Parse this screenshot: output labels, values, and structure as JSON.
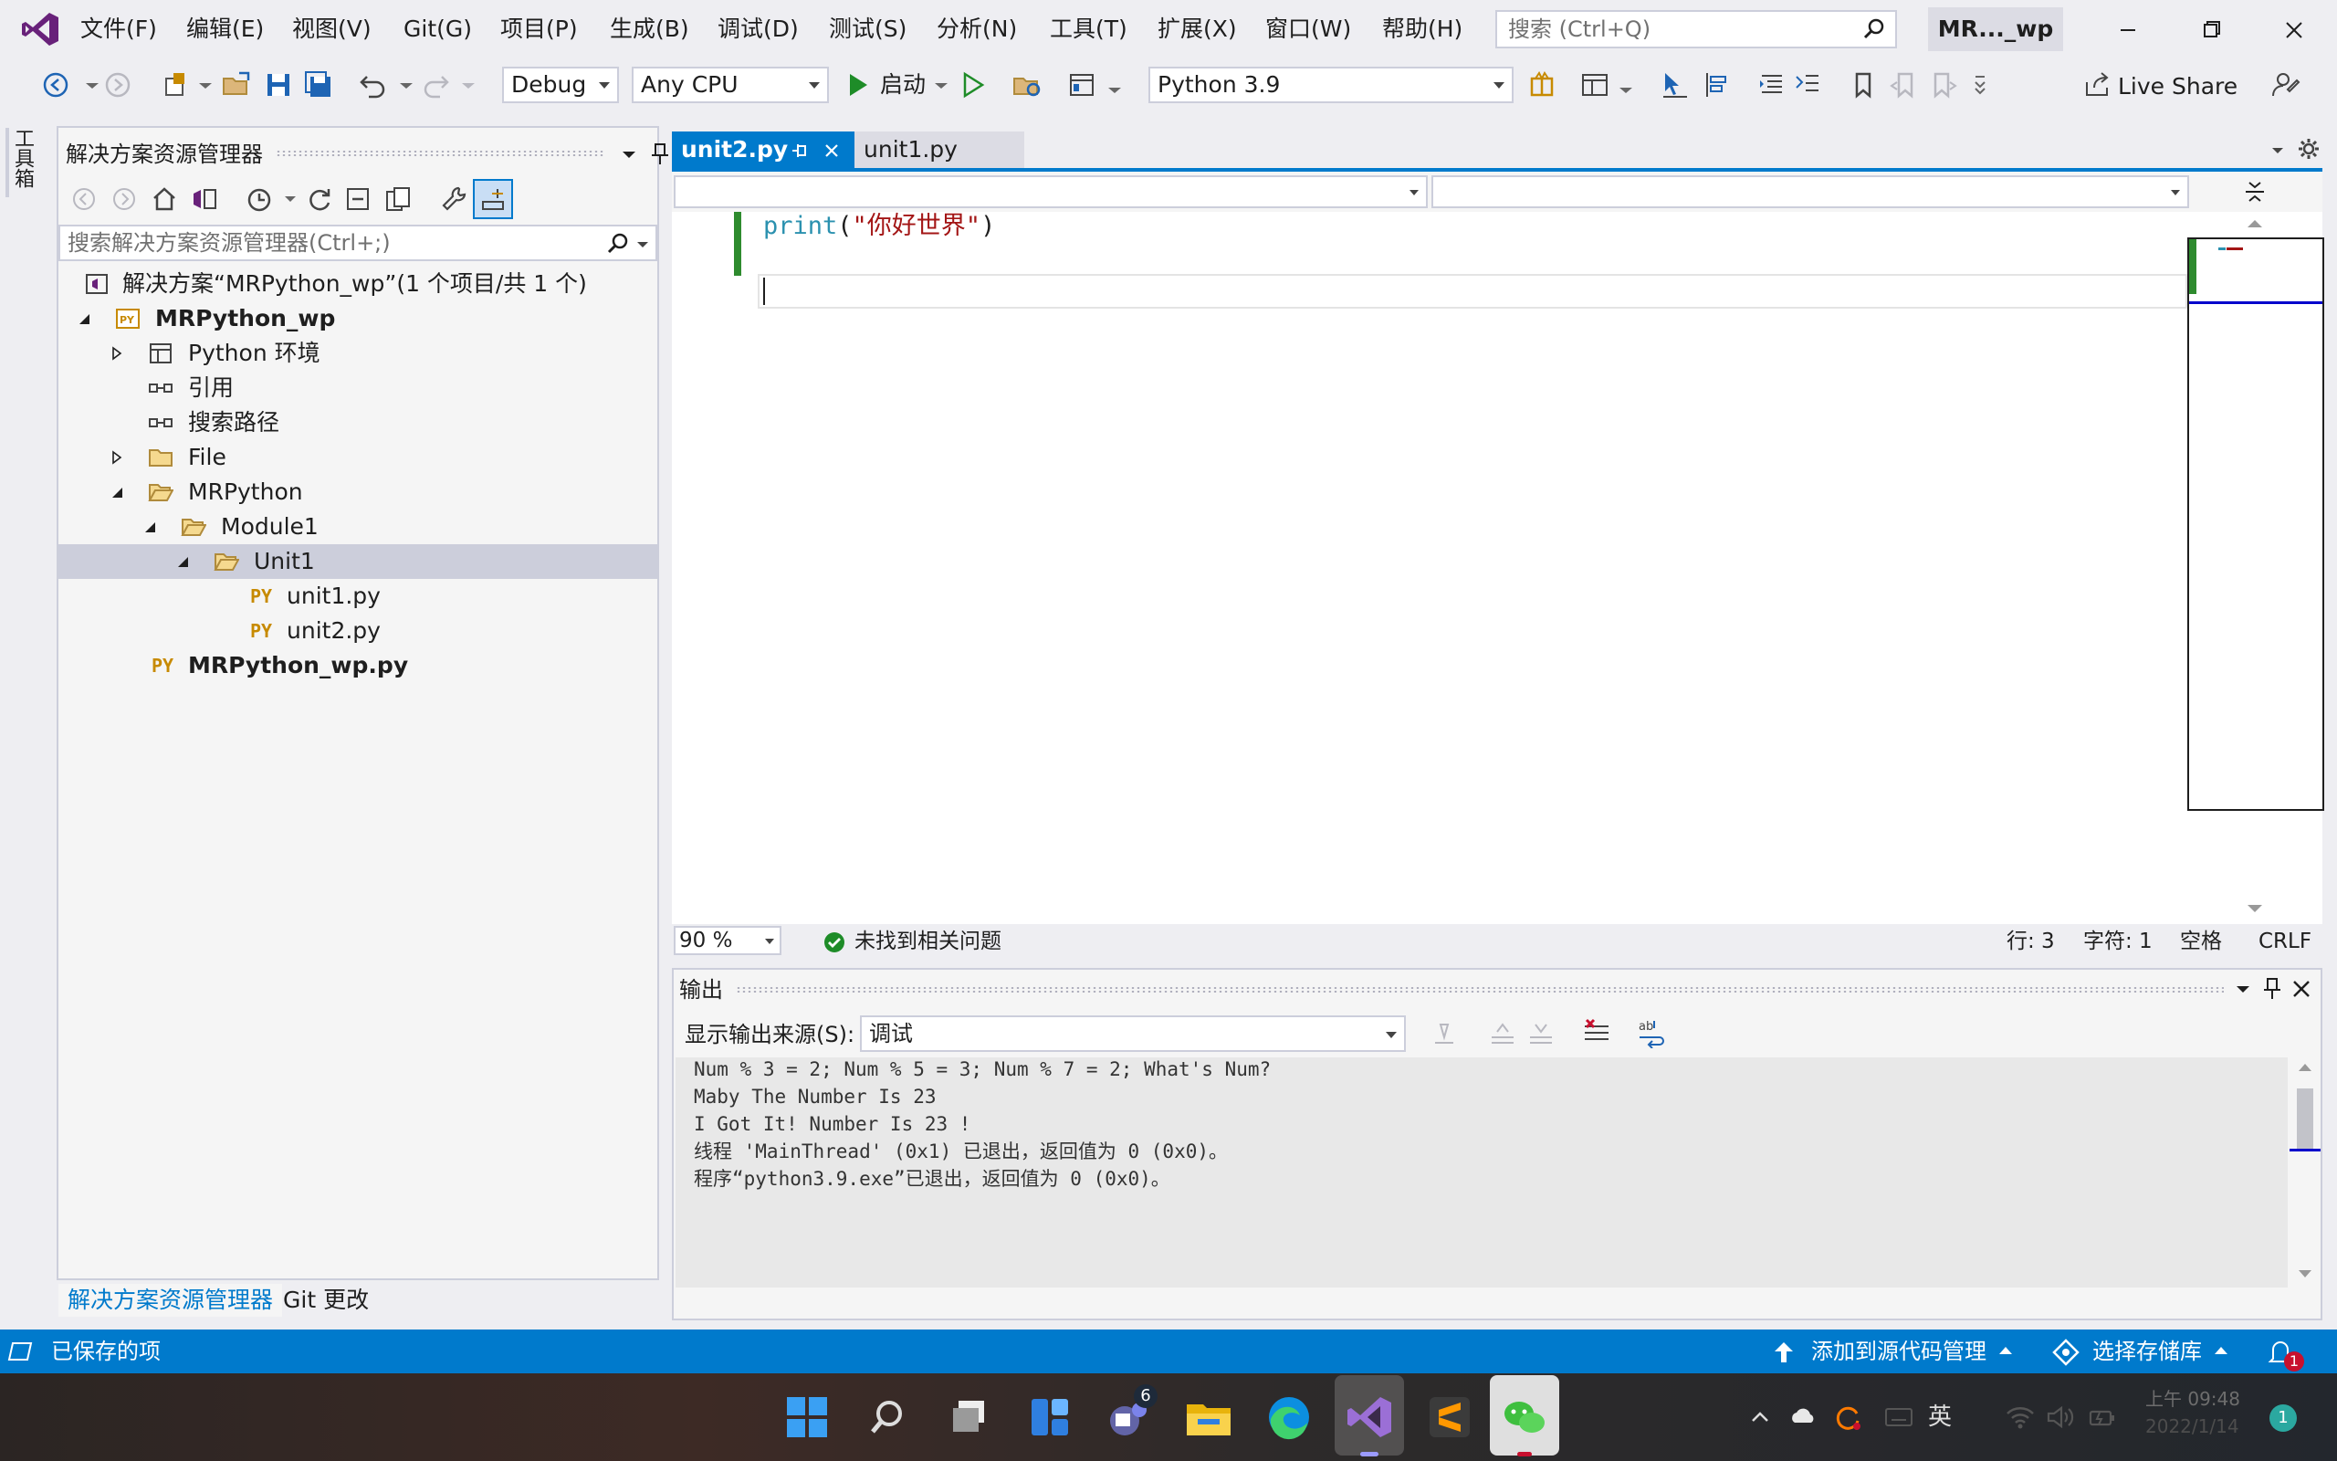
{
  "menu": {
    "items": [
      "文件(F)",
      "编辑(E)",
      "视图(V)",
      "Git(G)",
      "项目(P)",
      "生成(B)",
      "调试(D)",
      "测试(S)",
      "分析(N)",
      "工具(T)",
      "扩展(X)",
      "窗口(W)",
      "帮助(H)"
    ],
    "search_placeholder": "搜索 (Ctrl+Q)",
    "solution_badge": "MR..._wp"
  },
  "toolbar": {
    "config": "Debug",
    "platform": "Any CPU",
    "start_label": "启动",
    "interpreter": "Python 3.9",
    "live_share": "Live Share"
  },
  "toolbox": {
    "label": "工具箱"
  },
  "solution_explorer": {
    "title": "解决方案资源管理器",
    "search_placeholder": "搜索解决方案资源管理器(Ctrl+;)",
    "tree": [
      {
        "label": "解决方案“MRPython_wp”(1 个项目/共 1 个)"
      },
      {
        "label": "MRPython_wp",
        "badge": "PY"
      },
      {
        "label": "Python 环境"
      },
      {
        "label": "引用"
      },
      {
        "label": "搜索路径"
      },
      {
        "label": "File"
      },
      {
        "label": "MRPython"
      },
      {
        "label": "Module1"
      },
      {
        "label": "Unit1"
      },
      {
        "label": "unit1.py",
        "badge": "PY"
      },
      {
        "label": "unit2.py",
        "badge": "PY"
      },
      {
        "label": "MRPython_wp.py",
        "badge": "PY"
      }
    ],
    "bottom_tabs": [
      "解决方案资源管理器",
      "Git 更改"
    ]
  },
  "editor": {
    "tabs": [
      {
        "label": "unit2.py",
        "active": true
      },
      {
        "label": "unit1.py",
        "active": false
      }
    ],
    "code": {
      "fn": "print",
      "open_paren": "(",
      "string": "\"你好世界\"",
      "close_paren": ")"
    },
    "status": {
      "zoom": "90 %",
      "issues": "未找到相关问题",
      "line": "行: 3",
      "char": "字符: 1",
      "indent": "空格",
      "eol": "CRLF"
    }
  },
  "output": {
    "title": "输出",
    "source_label": "显示输出来源(S):",
    "source_value": "调试",
    "lines": [
      "Num % 3 = 2; Num % 5 = 3; Num % 7 = 2; What's Num?",
      "Maby The Number Is 23",
      "I Got It! Number Is 23 !",
      "线程 'MainThread' (0x1) 已退出，返回值为 0 (0x0)。",
      "程序“python3.9.exe”已退出，返回值为 0 (0x0)。"
    ]
  },
  "statusbar": {
    "saved": "已保存的项",
    "add_source": "添加到源代码管理",
    "select_repo": "选择存储库",
    "notification_count": "1"
  },
  "taskbar": {
    "teams_badge": "6",
    "ime": "英",
    "time": "上午 09:48",
    "date": "2022/1/14",
    "notification_badge": "1"
  },
  "colors": {
    "accent": "#007acc",
    "change_bar": "#2e8b2e",
    "string": "#a31515",
    "function": "#2b91af"
  }
}
